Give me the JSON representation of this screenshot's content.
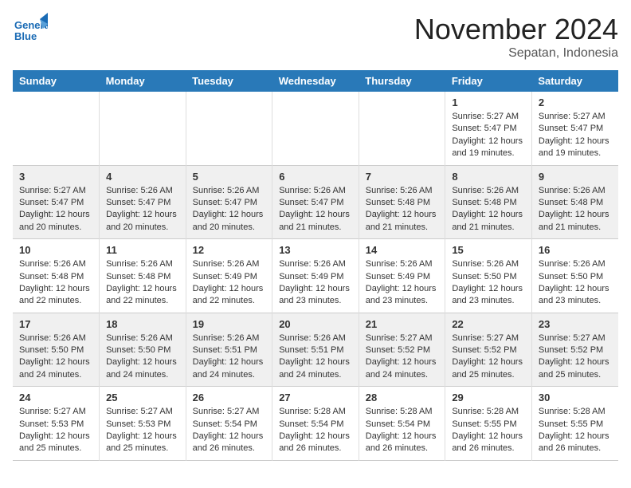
{
  "header": {
    "logo_line1": "General",
    "logo_line2": "Blue",
    "month": "November 2024",
    "location": "Sepatan, Indonesia"
  },
  "weekdays": [
    "Sunday",
    "Monday",
    "Tuesday",
    "Wednesday",
    "Thursday",
    "Friday",
    "Saturday"
  ],
  "weeks": [
    [
      {
        "day": "",
        "info": ""
      },
      {
        "day": "",
        "info": ""
      },
      {
        "day": "",
        "info": ""
      },
      {
        "day": "",
        "info": ""
      },
      {
        "day": "",
        "info": ""
      },
      {
        "day": "1",
        "info": "Sunrise: 5:27 AM\nSunset: 5:47 PM\nDaylight: 12 hours and 19 minutes."
      },
      {
        "day": "2",
        "info": "Sunrise: 5:27 AM\nSunset: 5:47 PM\nDaylight: 12 hours and 19 minutes."
      }
    ],
    [
      {
        "day": "3",
        "info": "Sunrise: 5:27 AM\nSunset: 5:47 PM\nDaylight: 12 hours and 20 minutes."
      },
      {
        "day": "4",
        "info": "Sunrise: 5:26 AM\nSunset: 5:47 PM\nDaylight: 12 hours and 20 minutes."
      },
      {
        "day": "5",
        "info": "Sunrise: 5:26 AM\nSunset: 5:47 PM\nDaylight: 12 hours and 20 minutes."
      },
      {
        "day": "6",
        "info": "Sunrise: 5:26 AM\nSunset: 5:47 PM\nDaylight: 12 hours and 21 minutes."
      },
      {
        "day": "7",
        "info": "Sunrise: 5:26 AM\nSunset: 5:48 PM\nDaylight: 12 hours and 21 minutes."
      },
      {
        "day": "8",
        "info": "Sunrise: 5:26 AM\nSunset: 5:48 PM\nDaylight: 12 hours and 21 minutes."
      },
      {
        "day": "9",
        "info": "Sunrise: 5:26 AM\nSunset: 5:48 PM\nDaylight: 12 hours and 21 minutes."
      }
    ],
    [
      {
        "day": "10",
        "info": "Sunrise: 5:26 AM\nSunset: 5:48 PM\nDaylight: 12 hours and 22 minutes."
      },
      {
        "day": "11",
        "info": "Sunrise: 5:26 AM\nSunset: 5:48 PM\nDaylight: 12 hours and 22 minutes."
      },
      {
        "day": "12",
        "info": "Sunrise: 5:26 AM\nSunset: 5:49 PM\nDaylight: 12 hours and 22 minutes."
      },
      {
        "day": "13",
        "info": "Sunrise: 5:26 AM\nSunset: 5:49 PM\nDaylight: 12 hours and 23 minutes."
      },
      {
        "day": "14",
        "info": "Sunrise: 5:26 AM\nSunset: 5:49 PM\nDaylight: 12 hours and 23 minutes."
      },
      {
        "day": "15",
        "info": "Sunrise: 5:26 AM\nSunset: 5:50 PM\nDaylight: 12 hours and 23 minutes."
      },
      {
        "day": "16",
        "info": "Sunrise: 5:26 AM\nSunset: 5:50 PM\nDaylight: 12 hours and 23 minutes."
      }
    ],
    [
      {
        "day": "17",
        "info": "Sunrise: 5:26 AM\nSunset: 5:50 PM\nDaylight: 12 hours and 24 minutes."
      },
      {
        "day": "18",
        "info": "Sunrise: 5:26 AM\nSunset: 5:50 PM\nDaylight: 12 hours and 24 minutes."
      },
      {
        "day": "19",
        "info": "Sunrise: 5:26 AM\nSunset: 5:51 PM\nDaylight: 12 hours and 24 minutes."
      },
      {
        "day": "20",
        "info": "Sunrise: 5:26 AM\nSunset: 5:51 PM\nDaylight: 12 hours and 24 minutes."
      },
      {
        "day": "21",
        "info": "Sunrise: 5:27 AM\nSunset: 5:52 PM\nDaylight: 12 hours and 24 minutes."
      },
      {
        "day": "22",
        "info": "Sunrise: 5:27 AM\nSunset: 5:52 PM\nDaylight: 12 hours and 25 minutes."
      },
      {
        "day": "23",
        "info": "Sunrise: 5:27 AM\nSunset: 5:52 PM\nDaylight: 12 hours and 25 minutes."
      }
    ],
    [
      {
        "day": "24",
        "info": "Sunrise: 5:27 AM\nSunset: 5:53 PM\nDaylight: 12 hours and 25 minutes."
      },
      {
        "day": "25",
        "info": "Sunrise: 5:27 AM\nSunset: 5:53 PM\nDaylight: 12 hours and 25 minutes."
      },
      {
        "day": "26",
        "info": "Sunrise: 5:27 AM\nSunset: 5:54 PM\nDaylight: 12 hours and 26 minutes."
      },
      {
        "day": "27",
        "info": "Sunrise: 5:28 AM\nSunset: 5:54 PM\nDaylight: 12 hours and 26 minutes."
      },
      {
        "day": "28",
        "info": "Sunrise: 5:28 AM\nSunset: 5:54 PM\nDaylight: 12 hours and 26 minutes."
      },
      {
        "day": "29",
        "info": "Sunrise: 5:28 AM\nSunset: 5:55 PM\nDaylight: 12 hours and 26 minutes."
      },
      {
        "day": "30",
        "info": "Sunrise: 5:28 AM\nSunset: 5:55 PM\nDaylight: 12 hours and 26 minutes."
      }
    ]
  ]
}
